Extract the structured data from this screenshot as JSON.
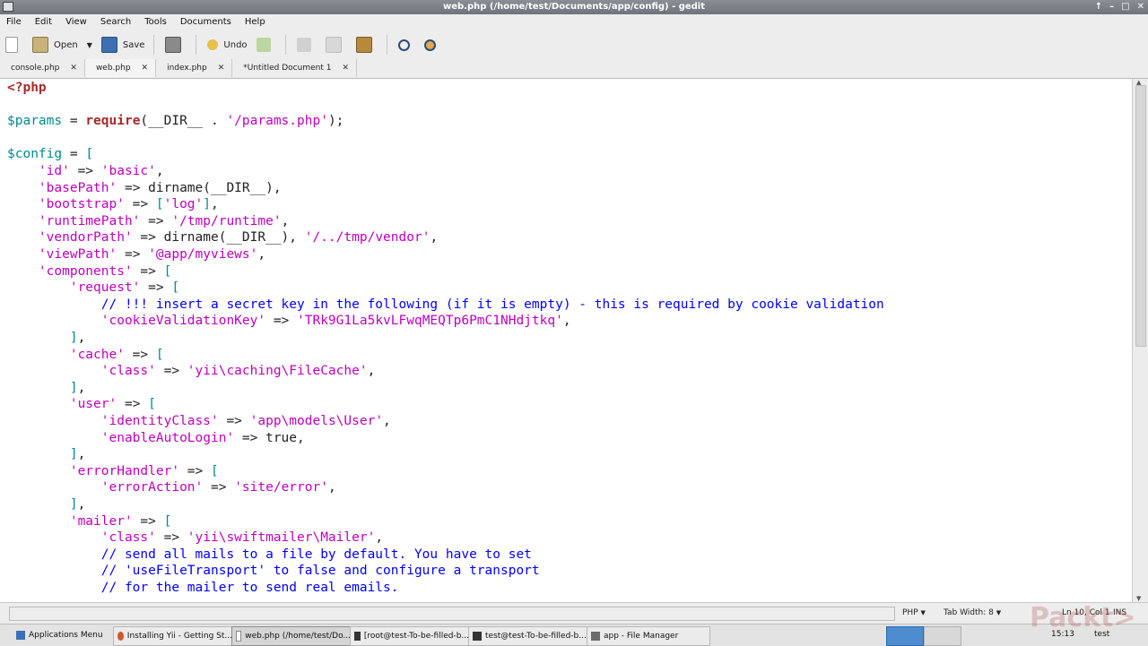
{
  "window": {
    "title": "web.php (/home/test/Documents/app/config) - gedit",
    "controls": [
      "↑",
      "–",
      "□",
      "✕"
    ]
  },
  "menu": [
    "File",
    "Edit",
    "View",
    "Search",
    "Tools",
    "Documents",
    "Help"
  ],
  "toolbar": {
    "open": "Open",
    "save": "Save",
    "undo": "Undo"
  },
  "tabs": [
    {
      "label": "console.php"
    },
    {
      "label": "web.php"
    },
    {
      "label": "index.php"
    },
    {
      "label": "*Untitled Document 1"
    }
  ],
  "code": [
    [
      [
        "k",
        "<?php"
      ]
    ],
    [],
    [
      [
        "v",
        "$params"
      ],
      [
        "p",
        " = "
      ],
      [
        "k",
        "require"
      ],
      [
        "p",
        "(__DIR__ . "
      ],
      [
        "s",
        "'/params.php'"
      ],
      [
        "p",
        ");"
      ]
    ],
    [],
    [
      [
        "v",
        "$config"
      ],
      [
        "p",
        " = "
      ],
      [
        "v",
        "["
      ]
    ],
    [
      [
        "p",
        "    "
      ],
      [
        "s",
        "'id'"
      ],
      [
        "p",
        " => "
      ],
      [
        "s",
        "'basic'"
      ],
      [
        "p",
        ","
      ]
    ],
    [
      [
        "p",
        "    "
      ],
      [
        "s",
        "'basePath'"
      ],
      [
        "p",
        " => dirname(__DIR__),"
      ]
    ],
    [
      [
        "p",
        "    "
      ],
      [
        "s",
        "'bootstrap'"
      ],
      [
        "p",
        " => "
      ],
      [
        "v",
        "["
      ],
      [
        "s",
        "'log'"
      ],
      [
        "v",
        "]"
      ],
      [
        "p",
        ","
      ]
    ],
    [
      [
        "p",
        "    "
      ],
      [
        "s",
        "'runtimePath'"
      ],
      [
        "p",
        " => "
      ],
      [
        "s",
        "'/tmp/runtime'"
      ],
      [
        "p",
        ","
      ]
    ],
    [
      [
        "p",
        "    "
      ],
      [
        "s",
        "'vendorPath'"
      ],
      [
        "p",
        " => dirname(__DIR__), "
      ],
      [
        "s",
        "'/../tmp/vendor'"
      ],
      [
        "p",
        ","
      ]
    ],
    [
      [
        "p",
        "    "
      ],
      [
        "s",
        "'viewPath'"
      ],
      [
        "p",
        " => "
      ],
      [
        "s",
        "'@app/myviews'"
      ],
      [
        "p",
        ","
      ]
    ],
    [
      [
        "p",
        "    "
      ],
      [
        "s",
        "'components'"
      ],
      [
        "p",
        " => "
      ],
      [
        "v",
        "["
      ]
    ],
    [
      [
        "p",
        "        "
      ],
      [
        "s",
        "'request'"
      ],
      [
        "p",
        " => "
      ],
      [
        "v",
        "["
      ]
    ],
    [
      [
        "p",
        "            "
      ],
      [
        "c",
        "// !!! insert a secret key in the following (if it is empty) - this is required by cookie validation"
      ]
    ],
    [
      [
        "p",
        "            "
      ],
      [
        "s",
        "'cookieValidationKey'"
      ],
      [
        "p",
        " => "
      ],
      [
        "s",
        "'TRk9G1La5kvLFwqMEQTp6PmC1NHdjtkq'"
      ],
      [
        "p",
        ","
      ]
    ],
    [
      [
        "p",
        "        "
      ],
      [
        "v",
        "]"
      ],
      [
        "p",
        ","
      ]
    ],
    [
      [
        "p",
        "        "
      ],
      [
        "s",
        "'cache'"
      ],
      [
        "p",
        " => "
      ],
      [
        "v",
        "["
      ]
    ],
    [
      [
        "p",
        "            "
      ],
      [
        "s",
        "'class'"
      ],
      [
        "p",
        " => "
      ],
      [
        "s",
        "'yii\\caching\\FileCache'"
      ],
      [
        "p",
        ","
      ]
    ],
    [
      [
        "p",
        "        "
      ],
      [
        "v",
        "]"
      ],
      [
        "p",
        ","
      ]
    ],
    [
      [
        "p",
        "        "
      ],
      [
        "s",
        "'user'"
      ],
      [
        "p",
        " => "
      ],
      [
        "v",
        "["
      ]
    ],
    [
      [
        "p",
        "            "
      ],
      [
        "s",
        "'identityClass'"
      ],
      [
        "p",
        " => "
      ],
      [
        "s",
        "'app\\models\\User'"
      ],
      [
        "p",
        ","
      ]
    ],
    [
      [
        "p",
        "            "
      ],
      [
        "s",
        "'enableAutoLogin'"
      ],
      [
        "p",
        " => true,"
      ]
    ],
    [
      [
        "p",
        "        "
      ],
      [
        "v",
        "]"
      ],
      [
        "p",
        ","
      ]
    ],
    [
      [
        "p",
        "        "
      ],
      [
        "s",
        "'errorHandler'"
      ],
      [
        "p",
        " => "
      ],
      [
        "v",
        "["
      ]
    ],
    [
      [
        "p",
        "            "
      ],
      [
        "s",
        "'errorAction'"
      ],
      [
        "p",
        " => "
      ],
      [
        "s",
        "'site/error'"
      ],
      [
        "p",
        ","
      ]
    ],
    [
      [
        "p",
        "        "
      ],
      [
        "v",
        "]"
      ],
      [
        "p",
        ","
      ]
    ],
    [
      [
        "p",
        "        "
      ],
      [
        "s",
        "'mailer'"
      ],
      [
        "p",
        " => "
      ],
      [
        "v",
        "["
      ]
    ],
    [
      [
        "p",
        "            "
      ],
      [
        "s",
        "'class'"
      ],
      [
        "p",
        " => "
      ],
      [
        "s",
        "'yii\\swiftmailer\\Mailer'"
      ],
      [
        "p",
        ","
      ]
    ],
    [
      [
        "p",
        "            "
      ],
      [
        "c",
        "// send all mails to a file by default. You have to set"
      ]
    ],
    [
      [
        "p",
        "            "
      ],
      [
        "c",
        "// 'useFileTransport' to false and configure a transport"
      ]
    ],
    [
      [
        "p",
        "            "
      ],
      [
        "c",
        "// for the mailer to send real emails."
      ]
    ]
  ],
  "status": {
    "language": "PHP",
    "tab_width": "Tab Width: 8",
    "position": "Ln 10, Col 1",
    "mode": "INS"
  },
  "taskbar": [
    {
      "label": "Applications Menu"
    },
    {
      "label": "Installing Yii - Getting St..."
    },
    {
      "label": "web.php (/home/test/Do..."
    },
    {
      "label": "[root@test-To-be-filled-b..."
    },
    {
      "label": "test@test-To-be-filled-b..."
    },
    {
      "label": "app - File Manager"
    }
  ],
  "clock": "15:13",
  "user": "test",
  "watermark": "Packt>"
}
